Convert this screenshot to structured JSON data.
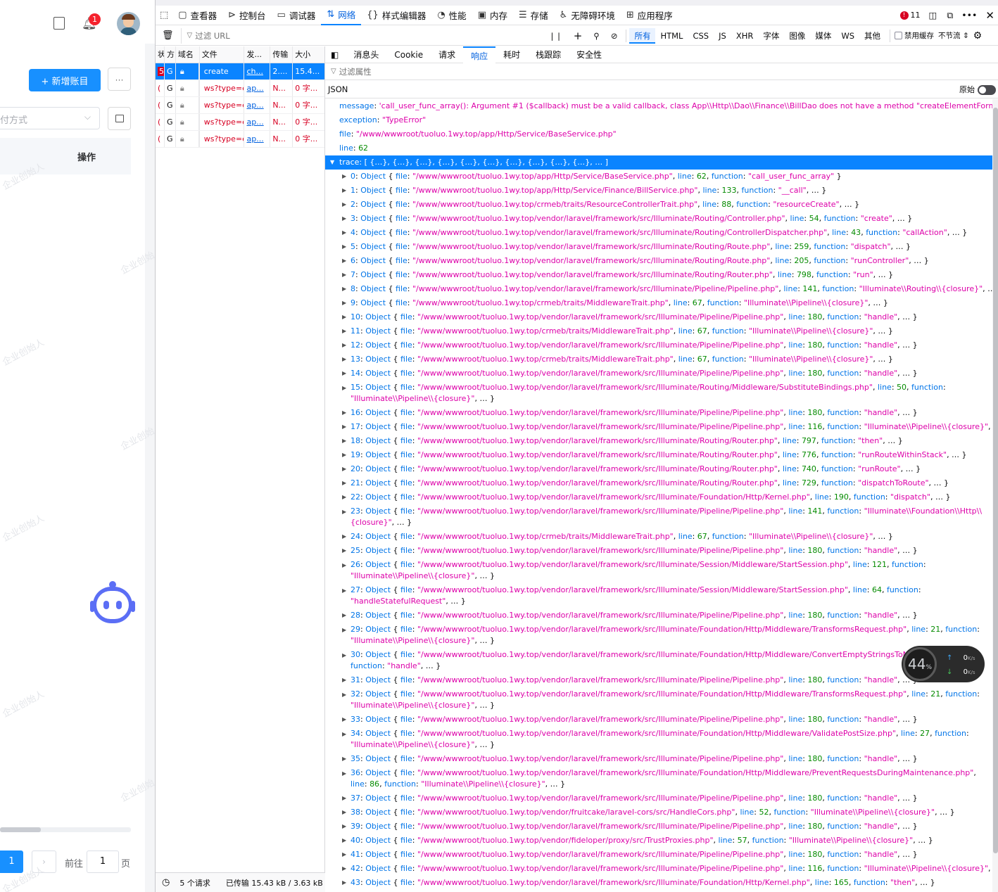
{
  "left_app": {
    "notification_count": "1",
    "add_account_button": "+ 新增账目",
    "more_button": "···",
    "select_partial": "付方式",
    "column_operation": "操作",
    "pagination": {
      "current": "1",
      "goto_label": "前往",
      "goto_value": "1",
      "page_suffix": "页"
    },
    "watermark": "企业创始人"
  },
  "devtools": {
    "toolbar": {
      "tabs": [
        {
          "label": "查看器",
          "icon": "inspector-icon"
        },
        {
          "label": "控制台",
          "icon": "console-icon"
        },
        {
          "label": "调试器",
          "icon": "debugger-icon"
        },
        {
          "label": "网络",
          "icon": "network-icon",
          "selected": true
        },
        {
          "label": "样式编辑器",
          "icon": "style-editor-icon"
        },
        {
          "label": "性能",
          "icon": "performance-icon"
        },
        {
          "label": "内存",
          "icon": "memory-icon"
        },
        {
          "label": "存储",
          "icon": "storage-icon"
        },
        {
          "label": "无障碍环境",
          "icon": "accessibility-icon"
        },
        {
          "label": "应用程序",
          "icon": "application-icon"
        }
      ],
      "error_count": "11"
    },
    "filter_bar": {
      "filter_url_placeholder": "过滤 URL",
      "types": [
        "所有",
        "HTML",
        "CSS",
        "JS",
        "XHR",
        "字体",
        "图像",
        "媒体",
        "WS",
        "其他"
      ],
      "disable_cache": "禁用缓存",
      "throttle": "不节流 ⇕"
    },
    "request_list": {
      "headers": [
        "状",
        "方",
        "域名",
        "文件",
        "发...",
        "传输",
        "大小"
      ],
      "rows": [
        {
          "status": "5",
          "method": "G",
          "domain": "...",
          "file": "create",
          "initiator": "ch...",
          "transferred": "2....",
          "size": "15.4..."
        },
        {
          "status": "(",
          "method": "G",
          "domain": "...",
          "file": "ws?type=e",
          "initiator": "ap...",
          "transferred": "N...",
          "size": "0 字..."
        },
        {
          "status": "(",
          "method": "G",
          "domain": "...",
          "file": "ws?type=e",
          "initiator": "ap...",
          "transferred": "N...",
          "size": "0 字..."
        },
        {
          "status": "(",
          "method": "G",
          "domain": "...",
          "file": "ws?type=e",
          "initiator": "ap...",
          "transferred": "N...",
          "size": "0 字..."
        },
        {
          "status": "(",
          "method": "G",
          "domain": "...",
          "file": "ws?type=e",
          "initiator": "ap...",
          "transferred": "N...",
          "size": "0 字..."
        }
      ]
    },
    "status_bar": {
      "requests": "5 个请求",
      "transferred": "已传输 15.43 kB / 3.63 kB"
    },
    "detail": {
      "tabs": [
        "消息头",
        "Cookie",
        "请求",
        "响应",
        "耗时",
        "栈跟踪",
        "安全性"
      ],
      "selected_tab": "响应",
      "filter_placeholder": "过滤属性",
      "json_label": "JSON",
      "raw_label": "原始",
      "message": "'call_user_func_array(): Argument #1 ($callback) must be a valid callback, class App\\\\Http\\\\Dao\\\\Finance\\\\BillDao does not have a method \"createElementForm\"'",
      "exception": "\"TypeError\"",
      "file": "\"/www/wwwroot/tuoluo.1wy.top/app/Http/Service/BaseService.php\"",
      "line": "62",
      "trace_summary": "[ {…}, {…}, {…}, {…}, {…}, {…}, {…}, {…}, {…}, {…}, … ]",
      "trace": [
        {
          "i": "0",
          "file": "\"/www/wwwroot/tuoluo.1wy.top/app/Http/Service/BaseService.php\"",
          "line": "62",
          "function": "\"call_user_func_array\"",
          "end": " }"
        },
        {
          "i": "1",
          "file": "\"/www/wwwroot/tuoluo.1wy.top/app/Http/Service/Finance/BillService.php\"",
          "line": "133",
          "function": "\"__call\"",
          "end": ", … }"
        },
        {
          "i": "2",
          "file": "\"/www/wwwroot/tuoluo.1wy.top/crmeb/traits/ResourceControllerTrait.php\"",
          "line": "88",
          "function": "\"resourceCreate\"",
          "end": ", … }"
        },
        {
          "i": "3",
          "file": "\"/www/wwwroot/tuoluo.1wy.top/vendor/laravel/framework/src/Illuminate/Routing/Controller.php\"",
          "line": "54",
          "function": "\"create\"",
          "end": ", … }"
        },
        {
          "i": "4",
          "file": "\"/www/wwwroot/tuoluo.1wy.top/vendor/laravel/framework/src/Illuminate/Routing/ControllerDispatcher.php\"",
          "line": "43",
          "function": "\"callAction\"",
          "end": ", … }"
        },
        {
          "i": "5",
          "file": "\"/www/wwwroot/tuoluo.1wy.top/vendor/laravel/framework/src/Illuminate/Routing/Route.php\"",
          "line": "259",
          "function": "\"dispatch\"",
          "end": ", … }"
        },
        {
          "i": "6",
          "file": "\"/www/wwwroot/tuoluo.1wy.top/vendor/laravel/framework/src/Illuminate/Routing/Route.php\"",
          "line": "205",
          "function": "\"runController\"",
          "end": ", … }"
        },
        {
          "i": "7",
          "file": "\"/www/wwwroot/tuoluo.1wy.top/vendor/laravel/framework/src/Illuminate/Routing/Router.php\"",
          "line": "798",
          "function": "\"run\"",
          "end": ", … }"
        },
        {
          "i": "8",
          "file": "\"/www/wwwroot/tuoluo.1wy.top/vendor/laravel/framework/src/Illuminate/Pipeline/Pipeline.php\"",
          "line": "141",
          "function": "\"Illuminate\\\\Routing\\\\{closure}\"",
          "end": ", … }"
        },
        {
          "i": "9",
          "file": "\"/www/wwwroot/tuoluo.1wy.top/crmeb/traits/MiddlewareTrait.php\"",
          "line": "67",
          "function": "\"Illuminate\\\\Pipeline\\\\{closure}\"",
          "end": ", … }"
        },
        {
          "i": "10",
          "file": "\"/www/wwwroot/tuoluo.1wy.top/vendor/laravel/framework/src/Illuminate/Pipeline/Pipeline.php\"",
          "line": "180",
          "function": "\"handle\"",
          "end": ", … }"
        },
        {
          "i": "11",
          "file": "\"/www/wwwroot/tuoluo.1wy.top/crmeb/traits/MiddlewareTrait.php\"",
          "line": "67",
          "function": "\"Illuminate\\\\Pipeline\\\\{closure}\"",
          "end": ", … }"
        },
        {
          "i": "12",
          "file": "\"/www/wwwroot/tuoluo.1wy.top/vendor/laravel/framework/src/Illuminate/Pipeline/Pipeline.php\"",
          "line": "180",
          "function": "\"handle\"",
          "end": ", … }"
        },
        {
          "i": "13",
          "file": "\"/www/wwwroot/tuoluo.1wy.top/crmeb/traits/MiddlewareTrait.php\"",
          "line": "67",
          "function": "\"Illuminate\\\\Pipeline\\\\{closure}\"",
          "end": ", … }"
        },
        {
          "i": "14",
          "file": "\"/www/wwwroot/tuoluo.1wy.top/vendor/laravel/framework/src/Illuminate/Pipeline/Pipeline.php\"",
          "line": "180",
          "function": "\"handle\"",
          "end": ", … }"
        },
        {
          "i": "15",
          "file": "\"/www/wwwroot/tuoluo.1wy.top/vendor/laravel/framework/src/Illuminate/Routing/Middleware/SubstituteBindings.php\"",
          "line": "50",
          "function": "\"Illuminate\\\\Pipeline\\\\{closure}\"",
          "end": ", … }",
          "wrap": true
        },
        {
          "i": "16",
          "file": "\"/www/wwwroot/tuoluo.1wy.top/vendor/laravel/framework/src/Illuminate/Pipeline/Pipeline.php\"",
          "line": "180",
          "function": "\"handle\"",
          "end": ", … }"
        },
        {
          "i": "17",
          "file": "\"/www/wwwroot/tuoluo.1wy.top/vendor/laravel/framework/src/Illuminate/Pipeline/Pipeline.php\"",
          "line": "116",
          "function": "\"Illuminate\\\\Pipeline\\\\{closure}\"",
          "end": ", … }"
        },
        {
          "i": "18",
          "file": "\"/www/wwwroot/tuoluo.1wy.top/vendor/laravel/framework/src/Illuminate/Routing/Router.php\"",
          "line": "797",
          "function": "\"then\"",
          "end": ", … }"
        },
        {
          "i": "19",
          "file": "\"/www/wwwroot/tuoluo.1wy.top/vendor/laravel/framework/src/Illuminate/Routing/Router.php\"",
          "line": "776",
          "function": "\"runRouteWithinStack\"",
          "end": ", … }"
        },
        {
          "i": "20",
          "file": "\"/www/wwwroot/tuoluo.1wy.top/vendor/laravel/framework/src/Illuminate/Routing/Router.php\"",
          "line": "740",
          "function": "\"runRoute\"",
          "end": ", … }"
        },
        {
          "i": "21",
          "file": "\"/www/wwwroot/tuoluo.1wy.top/vendor/laravel/framework/src/Illuminate/Routing/Router.php\"",
          "line": "729",
          "function": "\"dispatchToRoute\"",
          "end": ", … }"
        },
        {
          "i": "22",
          "file": "\"/www/wwwroot/tuoluo.1wy.top/vendor/laravel/framework/src/Illuminate/Foundation/Http/Kernel.php\"",
          "line": "190",
          "function": "\"dispatch\"",
          "end": ", … }"
        },
        {
          "i": "23",
          "file": "\"/www/wwwroot/tuoluo.1wy.top/vendor/laravel/framework/src/Illuminate/Pipeline/Pipeline.php\"",
          "line": "141",
          "function": "\"Illuminate\\\\Foundation\\\\Http\\\\{closure}\"",
          "end": ", … }",
          "wrap": true
        },
        {
          "i": "24",
          "file": "\"/www/wwwroot/tuoluo.1wy.top/crmeb/traits/MiddlewareTrait.php\"",
          "line": "67",
          "function": "\"Illuminate\\\\Pipeline\\\\{closure}\"",
          "end": ", … }"
        },
        {
          "i": "25",
          "file": "\"/www/wwwroot/tuoluo.1wy.top/vendor/laravel/framework/src/Illuminate/Pipeline/Pipeline.php\"",
          "line": "180",
          "function": "\"handle\"",
          "end": ", … }"
        },
        {
          "i": "26",
          "file": "\"/www/wwwroot/tuoluo.1wy.top/vendor/laravel/framework/src/Illuminate/Session/Middleware/StartSession.php\"",
          "line": "121",
          "function": "\"Illuminate\\\\Pipeline\\\\{closure}\"",
          "end": ", … }",
          "wrap": true
        },
        {
          "i": "27",
          "file": "\"/www/wwwroot/tuoluo.1wy.top/vendor/laravel/framework/src/Illuminate/Session/Middleware/StartSession.php\"",
          "line": "64",
          "function": "\"handleStatefulRequest\"",
          "end": ", … }",
          "wrap": true
        },
        {
          "i": "28",
          "file": "\"/www/wwwroot/tuoluo.1wy.top/vendor/laravel/framework/src/Illuminate/Pipeline/Pipeline.php\"",
          "line": "180",
          "function": "\"handle\"",
          "end": ", … }"
        },
        {
          "i": "29",
          "file": "\"/www/wwwroot/tuoluo.1wy.top/vendor/laravel/framework/src/Illuminate/Foundation/Http/Middleware/TransformsRequest.php\"",
          "line": "21",
          "function": "\"Illuminate\\\\Pipeline\\\\{closure}\"",
          "end": ", … }",
          "wrap": true
        },
        {
          "i": "30",
          "file": "\"/www/wwwroot/tuoluo.1wy.top/vendor/laravel/framework/src/Illuminate/Foundation/Http/Middleware/ConvertEmptyStringsToNull.php\"",
          "line": "31",
          "function": "\"handle\"",
          "end": ", … }",
          "wrap": true
        },
        {
          "i": "31",
          "file": "\"/www/wwwroot/tuoluo.1wy.top/vendor/laravel/framework/src/Illuminate/Pipeline/Pipeline.php\"",
          "line": "180",
          "function": "\"handle\"",
          "end": ", … }"
        },
        {
          "i": "32",
          "file": "\"/www/wwwroot/tuoluo.1wy.top/vendor/laravel/framework/src/Illuminate/Foundation/Http/Middleware/TransformsRequest.php\"",
          "line": "21",
          "function": "\"Illuminate\\\\Pipeline\\\\{closure}\"",
          "end": ", … }",
          "wrap": true
        },
        {
          "i": "33",
          "file": "\"/www/wwwroot/tuoluo.1wy.top/vendor/laravel/framework/src/Illuminate/Pipeline/Pipeline.php\"",
          "line": "180",
          "function": "\"handle\"",
          "end": ", … }"
        },
        {
          "i": "34",
          "file": "\"/www/wwwroot/tuoluo.1wy.top/vendor/laravel/framework/src/Illuminate/Foundation/Http/Middleware/ValidatePostSize.php\"",
          "line": "27",
          "function": "\"Illuminate\\\\Pipeline\\\\{closure}\"",
          "end": ", … }",
          "wrap": true
        },
        {
          "i": "35",
          "file": "\"/www/wwwroot/tuoluo.1wy.top/vendor/laravel/framework/src/Illuminate/Pipeline/Pipeline.php\"",
          "line": "180",
          "function": "\"handle\"",
          "end": ", … }"
        },
        {
          "i": "36",
          "file": "\"/www/wwwroot/tuoluo.1wy.top/vendor/laravel/framework/src/Illuminate/Foundation/Http/Middleware/PreventRequestsDuringMaintenance.php\"",
          "line": "86",
          "function": "\"Illuminate\\\\Pipeline\\\\{closure}\"",
          "end": ", … }",
          "wrap": true
        },
        {
          "i": "37",
          "file": "\"/www/wwwroot/tuoluo.1wy.top/vendor/laravel/framework/src/Illuminate/Pipeline/Pipeline.php\"",
          "line": "180",
          "function": "\"handle\"",
          "end": ", … }"
        },
        {
          "i": "38",
          "file": "\"/www/wwwroot/tuoluo.1wy.top/vendor/fruitcake/laravel-cors/src/HandleCors.php\"",
          "line": "52",
          "function": "\"Illuminate\\\\Pipeline\\\\{closure}\"",
          "end": ", … }"
        },
        {
          "i": "39",
          "file": "\"/www/wwwroot/tuoluo.1wy.top/vendor/laravel/framework/src/Illuminate/Pipeline/Pipeline.php\"",
          "line": "180",
          "function": "\"handle\"",
          "end": ", … }"
        },
        {
          "i": "40",
          "file": "\"/www/wwwroot/tuoluo.1wy.top/vendor/fideloper/proxy/src/TrustProxies.php\"",
          "line": "57",
          "function": "\"Illuminate\\\\Pipeline\\\\{closure}\"",
          "end": ", … }"
        },
        {
          "i": "41",
          "file": "\"/www/wwwroot/tuoluo.1wy.top/vendor/laravel/framework/src/Illuminate/Pipeline/Pipeline.php\"",
          "line": "180",
          "function": "\"handle\"",
          "end": ", … }"
        },
        {
          "i": "42",
          "file": "\"/www/wwwroot/tuoluo.1wy.top/vendor/laravel/framework/src/Illuminate/Pipeline/Pipeline.php\"",
          "line": "116",
          "function": "\"Illuminate\\\\Pipeline\\\\{closure}\"",
          "end": ", … }"
        },
        {
          "i": "43",
          "file": "\"/www/wwwroot/tuoluo.1wy.top/vendor/laravel/framework/src/Illuminate/Foundation/Http/Kernel.php\"",
          "line": "165",
          "function": "\"then\"",
          "end": ", … }"
        }
      ]
    }
  },
  "speed_widget": {
    "percent": "44",
    "percent_unit": "%",
    "up": "0",
    "down": "0",
    "unit": "K/s"
  },
  "colors": {
    "accent": "#0a84ff",
    "key": "#0074e8",
    "string": "#dd00a9",
    "number": "#058b00",
    "primary_button": "#1890ff",
    "badge": "#f5222d"
  }
}
